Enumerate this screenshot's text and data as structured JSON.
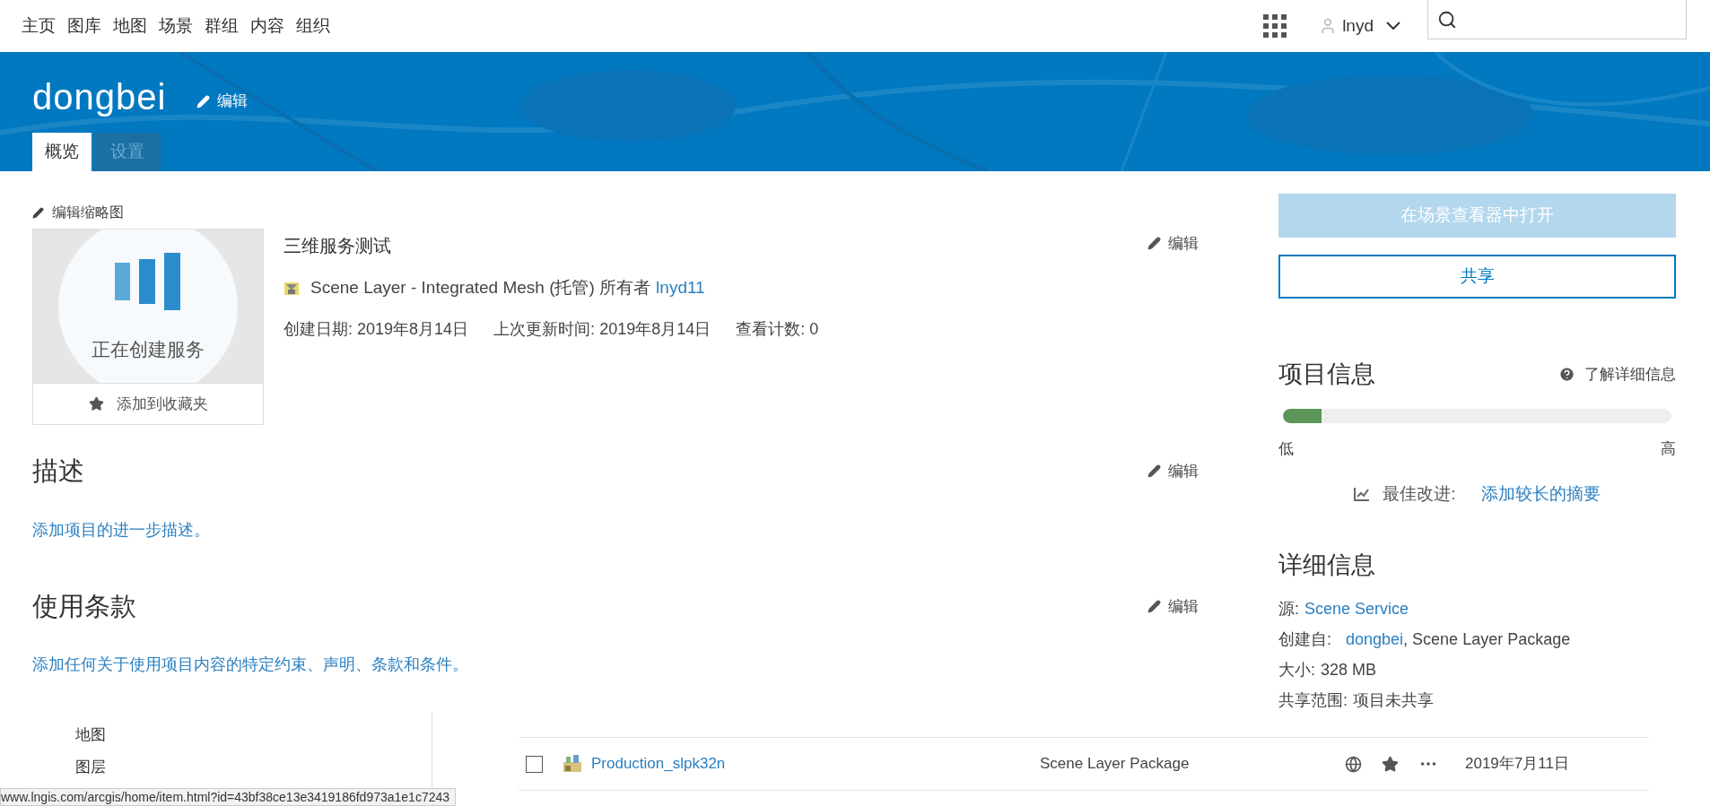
{
  "top_nav": {
    "links": [
      {
        "label": "主页"
      },
      {
        "label": "图库"
      },
      {
        "label": "地图"
      },
      {
        "label": "场景"
      },
      {
        "label": "群组"
      },
      {
        "label": "内容"
      },
      {
        "label": "组织"
      }
    ],
    "user": "lnyd"
  },
  "header": {
    "title": "dongbei",
    "edit": "编辑",
    "tabs": [
      {
        "label": "概览",
        "selected": true
      },
      {
        "label": "设置",
        "selected": false
      }
    ]
  },
  "thumbnail": {
    "edit": "编辑缩略图",
    "status": "正在创建服务",
    "favorite": "添加到收藏夹"
  },
  "summary": {
    "title": "三维服务测试",
    "edit": "编辑",
    "type": "Scene Layer - Integrated Mesh (托管) 所有者",
    "owner": "lnyd11",
    "meta": [
      {
        "label": "创建日期:",
        "value": "2019年8月14日"
      },
      {
        "label": "上次更新时间:",
        "value": "2019年8月14日"
      },
      {
        "label": "查看计数:",
        "value": "0"
      }
    ]
  },
  "description": {
    "heading": "描述",
    "edit": "编辑",
    "link": "添加项目的进一步描述。"
  },
  "terms": {
    "heading": "使用条款",
    "edit": "编辑",
    "link": "添加任何关于使用项目内容的特定约束、声明、条款和条件。"
  },
  "actions": [
    {
      "label": "在场景查看器中打开",
      "kind": "primary",
      "disabled": true
    },
    {
      "label": "共享",
      "kind": "outline",
      "disabled": false
    }
  ],
  "item_info": {
    "heading": "项目信息",
    "help": "了解详细信息",
    "level": 0.1,
    "low": "低",
    "high": "高",
    "best_label": "最佳改进:",
    "best_link": "添加较长的摘要"
  },
  "details": {
    "heading": "详细信息",
    "rows": [
      {
        "label": "源:",
        "link": "Scene Service"
      },
      {
        "label": "创建自:",
        "link": "dongbei",
        "text": ", Scene Layer Package"
      },
      {
        "label": "大小:",
        "text": "328 MB"
      },
      {
        "label": "共享范围:",
        "text": "项目未共享"
      }
    ]
  },
  "overlay": {
    "nav": [
      {
        "label": "地图"
      },
      {
        "label": "图层"
      }
    ],
    "row": {
      "checked": false,
      "name": "Production_slpk32n",
      "type": "Scene Layer Package",
      "date": "2019年7月11日"
    },
    "status_url": "www.lngis.com/arcgis/home/item.html?id=43bf38ce13e3419186fd973a1e1c7243"
  }
}
